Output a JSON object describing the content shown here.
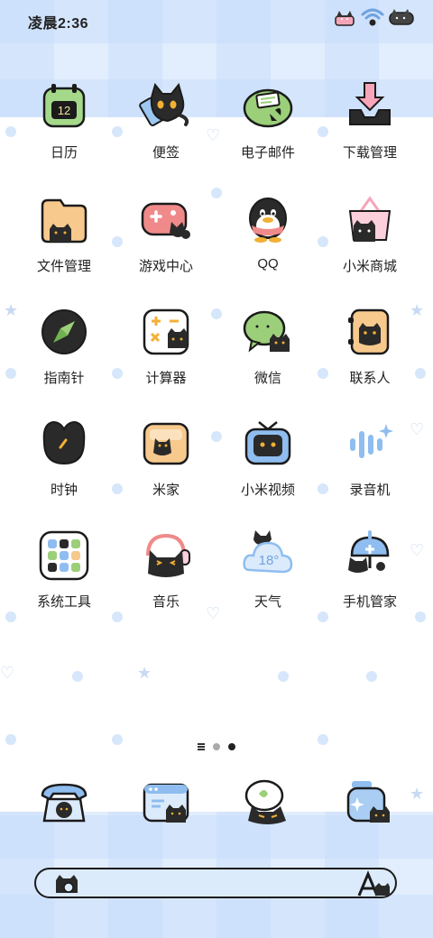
{
  "status_bar": {
    "time": "凌晨2:36"
  },
  "apps": [
    {
      "label": "日历",
      "icon": "calendar-icon",
      "day": "12"
    },
    {
      "label": "便签",
      "icon": "notes-cat-icon"
    },
    {
      "label": "电子邮件",
      "icon": "email-icon"
    },
    {
      "label": "下载管理",
      "icon": "download-icon"
    },
    {
      "label": "文件管理",
      "icon": "folder-icon"
    },
    {
      "label": "游戏中心",
      "icon": "gamepad-icon"
    },
    {
      "label": "QQ",
      "icon": "qq-penguin-icon"
    },
    {
      "label": "小米商城",
      "icon": "shopping-basket-icon"
    },
    {
      "label": "指南针",
      "icon": "compass-icon"
    },
    {
      "label": "计算器",
      "icon": "calculator-icon"
    },
    {
      "label": "微信",
      "icon": "wechat-icon"
    },
    {
      "label": "联系人",
      "icon": "contacts-icon"
    },
    {
      "label": "时钟",
      "icon": "clock-icon"
    },
    {
      "label": "米家",
      "icon": "mijia-icon"
    },
    {
      "label": "小米视频",
      "icon": "tv-icon"
    },
    {
      "label": "录音机",
      "icon": "recorder-icon"
    },
    {
      "label": "系统工具",
      "icon": "system-tools-folder-icon"
    },
    {
      "label": "音乐",
      "icon": "headphones-icon"
    },
    {
      "label": "天气",
      "icon": "weather-cloud-icon",
      "temp": "18°"
    },
    {
      "label": "手机管家",
      "icon": "security-icon"
    }
  ],
  "dock": [
    {
      "icon": "phone-icon"
    },
    {
      "icon": "browser-icon"
    },
    {
      "icon": "messages-icon"
    },
    {
      "icon": "theme-store-icon"
    }
  ],
  "pager": {
    "pages": 2,
    "active": 2
  },
  "colors": {
    "plaid": "#c8defc",
    "outline": "#1b1b1b",
    "cat": "#2a2a2a",
    "search_fill": "#dcebfc"
  }
}
